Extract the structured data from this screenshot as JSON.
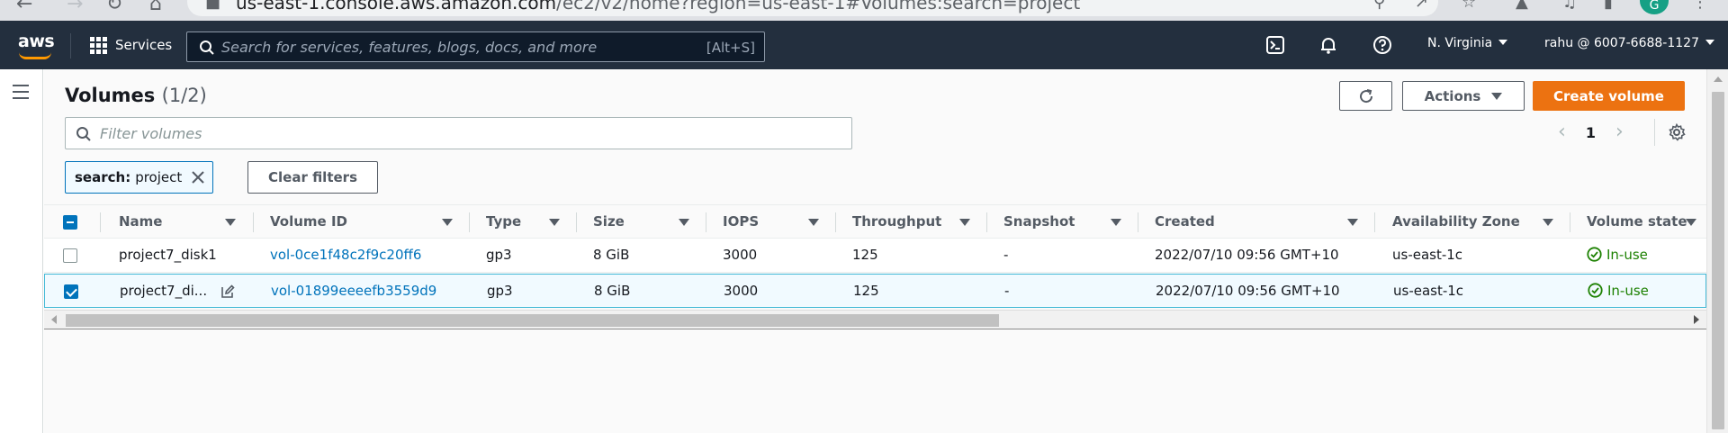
{
  "browser": {
    "url_host": "us-east-1.console.aws.amazon.com",
    "url_path": "/ec2/v2/home?region=us-east-1#Volumes:search=project",
    "profile_initial": "G"
  },
  "topnav": {
    "logo": "aws",
    "services_label": "Services",
    "search_placeholder": "Search for services, features, blogs, docs, and more",
    "search_shortcut": "[Alt+S]",
    "region": "N. Virginia",
    "account": "rahu @ 6007-6688-1127"
  },
  "page": {
    "title": "Volumes",
    "count": "(1/2)",
    "actions_label": "Actions",
    "create_label": "Create volume",
    "filter_placeholder": "Filter volumes",
    "page_number": "1",
    "token_key": "search:",
    "token_value": "project",
    "clear_filters_label": "Clear filters"
  },
  "table": {
    "columns": [
      "Name",
      "Volume ID",
      "Type",
      "Size",
      "IOPS",
      "Throughput",
      "Snapshot",
      "Created",
      "Availability Zone",
      "Volume state"
    ],
    "rows": [
      {
        "selected": false,
        "name": "project7_disk1",
        "volume_id": "vol-0ce1f48c2f9c20ff6",
        "type": "gp3",
        "size": "8 GiB",
        "iops": "3000",
        "throughput": "125",
        "snapshot": "-",
        "created": "2022/07/10 09:56 GMT+10",
        "az": "us-east-1c",
        "state": "In-use"
      },
      {
        "selected": true,
        "name": "project7_di...",
        "volume_id": "vol-01899eeeefb3559d9",
        "type": "gp3",
        "size": "8 GiB",
        "iops": "3000",
        "throughput": "125",
        "snapshot": "-",
        "created": "2022/07/10 09:56 GMT+10",
        "az": "us-east-1c",
        "state": "In-use"
      }
    ]
  },
  "colors": {
    "nav_bg": "#232f3e",
    "primary_orange": "#ec7211",
    "link_blue": "#0073bb",
    "success_green": "#1d8102"
  }
}
